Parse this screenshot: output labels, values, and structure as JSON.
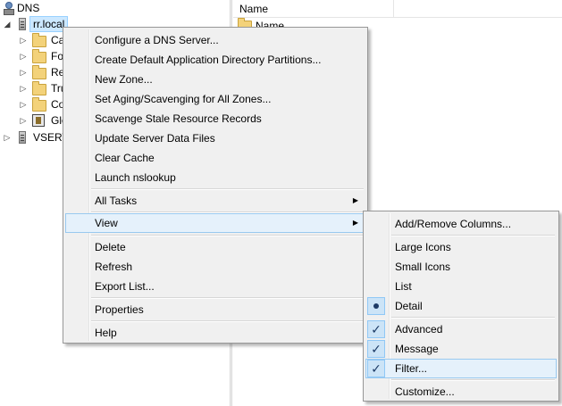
{
  "tree": {
    "root_label": "DNS",
    "server_label": "rr.local",
    "children": [
      {
        "label": "Ca"
      },
      {
        "label": "Fo"
      },
      {
        "label": "Re"
      },
      {
        "label": "Tru"
      },
      {
        "label": "Co"
      },
      {
        "label": "Glo"
      }
    ],
    "second_server_label": "VSERV"
  },
  "list": {
    "column_name": "Name",
    "first_item": "Name"
  },
  "context_menu": {
    "items": [
      "Configure a DNS Server...",
      "Create Default Application Directory Partitions...",
      "New Zone...",
      "Set Aging/Scavenging for All Zones...",
      "Scavenge Stale Resource Records",
      "Update Server Data Files",
      "Clear Cache",
      "Launch nslookup"
    ],
    "all_tasks": "All Tasks",
    "view": "View",
    "delete": "Delete",
    "refresh": "Refresh",
    "export_list": "Export List...",
    "properties": "Properties",
    "help": "Help",
    "submenu_arrow": "▶"
  },
  "view_submenu": {
    "add_remove_columns": "Add/Remove Columns...",
    "large_icons": "Large Icons",
    "small_icons": "Small Icons",
    "list": "List",
    "detail": "Detail",
    "advanced": "Advanced",
    "message": "Message",
    "filter": "Filter...",
    "customize": "Customize...",
    "checkmark": "✓"
  }
}
